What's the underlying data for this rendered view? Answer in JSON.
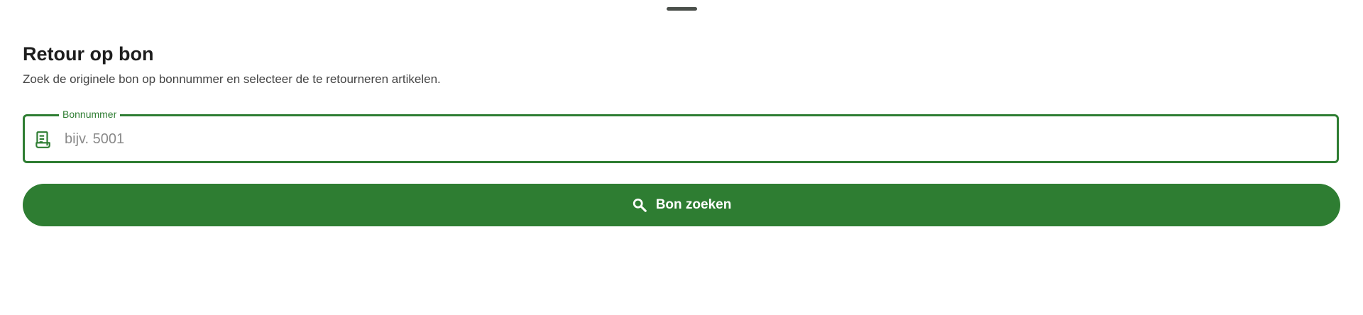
{
  "sheet": {
    "title": "Retour op bon",
    "subtitle": "Zoek de originele bon op bonnummer en selecteer de te retourneren artikelen."
  },
  "receipt_field": {
    "label": "Bonnummer",
    "value": "",
    "placeholder": "bijv. 5001",
    "icon": "receipt-icon"
  },
  "search_button": {
    "label": "Bon zoeken",
    "icon": "search-icon"
  },
  "colors": {
    "accent": "#2e7d32",
    "text": "#1d1d1d",
    "muted": "#454545",
    "background": "#ffffff"
  }
}
